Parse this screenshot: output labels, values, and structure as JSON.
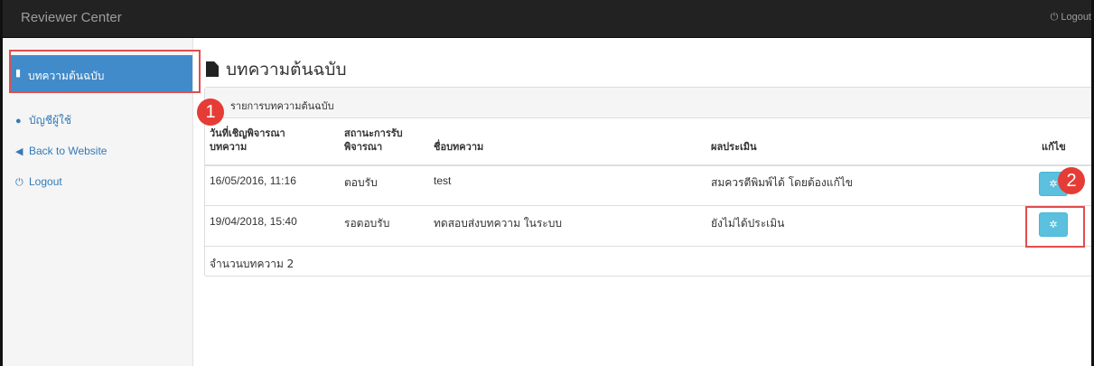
{
  "app": {
    "brand": "Reviewer Center",
    "top_logout": "Logout"
  },
  "sidebar": {
    "items": [
      {
        "label": "บทความต้นฉบับ",
        "icon": "file-icon",
        "active": true
      },
      {
        "label": "บัญชีผู้ใช้",
        "icon": "user-icon"
      },
      {
        "label": "Back to Website",
        "icon": "arrow-circle-left-icon"
      },
      {
        "label": "Logout",
        "icon": "power-icon"
      }
    ]
  },
  "main": {
    "title": "บทความต้นฉบับ",
    "panel_title": "รายการบทความต้นฉบับ",
    "columns": [
      "วันที่เชิญพิจารณาบทความ",
      "สถานะการรับพิจารณา",
      "ชื่อบทความ",
      "ผลประเมิน",
      "แก้ไข"
    ],
    "columns_display": {
      "invite_date_1": "วันที่เชิญพิจารณา",
      "invite_date_2": "บทความ",
      "status_1": "สถานะการรับ",
      "status_2": "พิจารณา"
    },
    "rows": [
      {
        "date": "16/05/2016, 11:16",
        "status": "ตอบรับ",
        "title": "test",
        "result": "สมควรตีพิมพ์ได้ โดยต้องแก้ไข"
      },
      {
        "date": "19/04/2018, 15:40",
        "status": "รอตอบรับ",
        "title": "ทดสอบส่งบทความ ในระบบ",
        "result": "ยังไม่ได้ประเมิน"
      }
    ],
    "count_text": "จำนวนบทความ 2"
  },
  "annotations": {
    "badge_1": "1",
    "badge_2": "2"
  },
  "colors": {
    "navbar": "#222222",
    "active_item": "#428bca",
    "info_button": "#5bc0de",
    "highlight": "#e24d4d"
  }
}
